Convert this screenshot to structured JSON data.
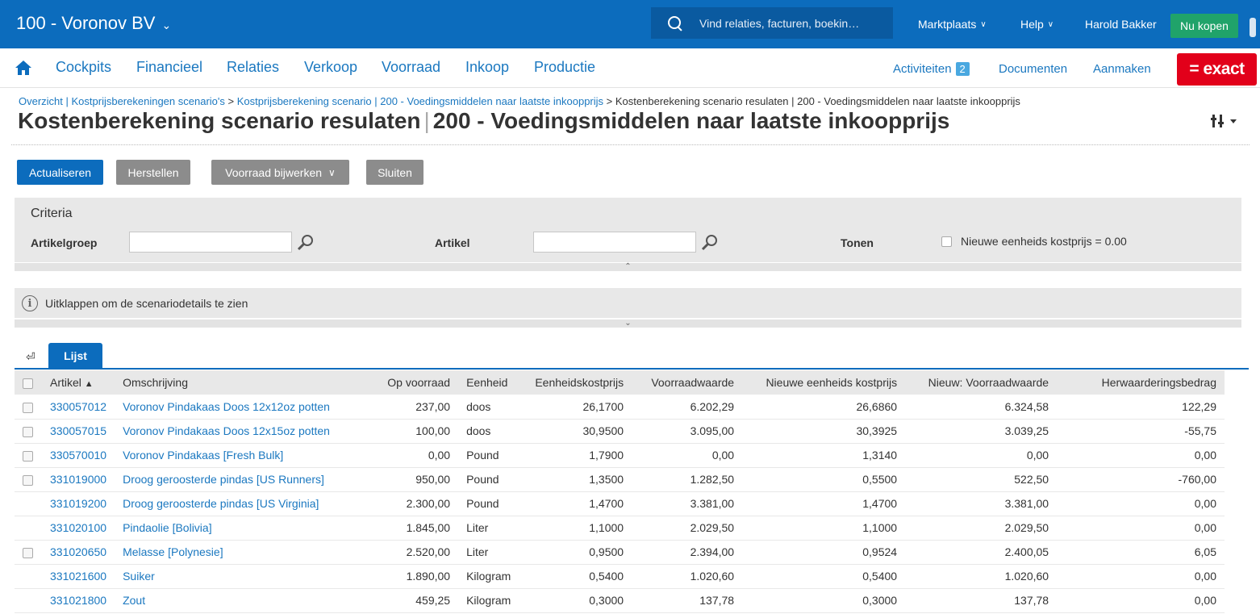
{
  "topbar": {
    "company": "100 - Voronov BV",
    "search_placeholder": "Vind relaties, facturen, boekin…",
    "marketplace": "Marktplaats",
    "help": "Help",
    "user": "Harold Bakker",
    "buy_now": "Nu kopen"
  },
  "nav": {
    "items": [
      "Cockpits",
      "Financieel",
      "Relaties",
      "Verkoop",
      "Voorraad",
      "Inkoop",
      "Productie"
    ],
    "activities": "Activiteiten",
    "activities_count": "2",
    "documents": "Documenten",
    "create": "Aanmaken",
    "logo": "= exact"
  },
  "breadcrumb": {
    "link1": "Overzicht | Kostprijsberekeningen scenario's",
    "sep": ">",
    "link2": "Kostprijsberekening scenario | 200 - Voedingsmiddelen naar laatste inkoopprijs",
    "current": "Kostenberekening scenario resulaten | 200 - Voedingsmiddelen naar laatste inkoopprijs"
  },
  "title": {
    "main": "Kostenberekening scenario resulaten",
    "sub": "200 - Voedingsmiddelen naar laatste inkoopprijs"
  },
  "toolbar": {
    "refresh": "Actualiseren",
    "restore": "Herstellen",
    "update_stock": "Voorraad bijwerken",
    "close": "Sluiten"
  },
  "criteria": {
    "title": "Criteria",
    "item_group_label": "Artikelgroep",
    "item_group_value": "",
    "item_label": "Artikel",
    "item_value": "",
    "show_label": "Tonen",
    "show_option": "Nieuwe eenheids kostprijs = 0.00"
  },
  "info": {
    "text": "Uitklappen om de scenariodetails te zien"
  },
  "tabs": {
    "list": "Lijst"
  },
  "table": {
    "columns": [
      "Artikel",
      "Omschrijving",
      "Op voorraad",
      "Eenheid",
      "Eenheidskostprijs",
      "Voorraadwaarde",
      "Nieuwe eenheids kostprijs",
      "Nieuw: Voorraadwaarde",
      "Herwaarderingsbedrag"
    ],
    "sort_indicator": "▲",
    "rows": [
      {
        "checkbox": true,
        "code": "330057012",
        "desc": "Voronov Pindakaas Doos 12x12oz potten",
        "stock": "237,00",
        "unit": "doos",
        "unit_cost": "26,1700",
        "stock_value": "6.202,29",
        "new_unit_cost": "26,6860",
        "new_stock_value": "6.324,58",
        "revaluation": "122,29"
      },
      {
        "checkbox": true,
        "code": "330057015",
        "desc": "Voronov Pindakaas Doos 12x15oz potten",
        "stock": "100,00",
        "unit": "doos",
        "unit_cost": "30,9500",
        "stock_value": "3.095,00",
        "new_unit_cost": "30,3925",
        "new_stock_value": "3.039,25",
        "revaluation": "-55,75"
      },
      {
        "checkbox": true,
        "code": "330570010",
        "desc": "Voronov Pindakaas [Fresh Bulk]",
        "stock": "0,00",
        "unit": "Pound",
        "unit_cost": "1,7900",
        "stock_value": "0,00",
        "new_unit_cost": "1,3140",
        "new_stock_value": "0,00",
        "revaluation": "0,00"
      },
      {
        "checkbox": true,
        "code": "331019000",
        "desc": "Droog geroosterde pindas [US Runners]",
        "stock": "950,00",
        "unit": "Pound",
        "unit_cost": "1,3500",
        "stock_value": "1.282,50",
        "new_unit_cost": "0,5500",
        "new_stock_value": "522,50",
        "revaluation": "-760,00"
      },
      {
        "checkbox": false,
        "code": "331019200",
        "desc": "Droog geroosterde pindas [US Virginia]",
        "stock": "2.300,00",
        "unit": "Pound",
        "unit_cost": "1,4700",
        "stock_value": "3.381,00",
        "new_unit_cost": "1,4700",
        "new_stock_value": "3.381,00",
        "revaluation": "0,00"
      },
      {
        "checkbox": false,
        "code": "331020100",
        "desc": "Pindaolie [Bolivia]",
        "stock": "1.845,00",
        "unit": "Liter",
        "unit_cost": "1,1000",
        "stock_value": "2.029,50",
        "new_unit_cost": "1,1000",
        "new_stock_value": "2.029,50",
        "revaluation": "0,00"
      },
      {
        "checkbox": true,
        "code": "331020650",
        "desc": "Melasse [Polynesie]",
        "stock": "2.520,00",
        "unit": "Liter",
        "unit_cost": "0,9500",
        "stock_value": "2.394,00",
        "new_unit_cost": "0,9524",
        "new_stock_value": "2.400,05",
        "revaluation": "6,05"
      },
      {
        "checkbox": false,
        "code": "331021600",
        "desc": "Suiker",
        "stock": "1.890,00",
        "unit": "Kilogram",
        "unit_cost": "0,5400",
        "stock_value": "1.020,60",
        "new_unit_cost": "0,5400",
        "new_stock_value": "1.020,60",
        "revaluation": "0,00"
      },
      {
        "checkbox": false,
        "code": "331021800",
        "desc": "Zout",
        "stock": "459,25",
        "unit": "Kilogram",
        "unit_cost": "0,3000",
        "stock_value": "137,78",
        "new_unit_cost": "0,3000",
        "new_stock_value": "137,78",
        "revaluation": "0,00"
      }
    ]
  }
}
